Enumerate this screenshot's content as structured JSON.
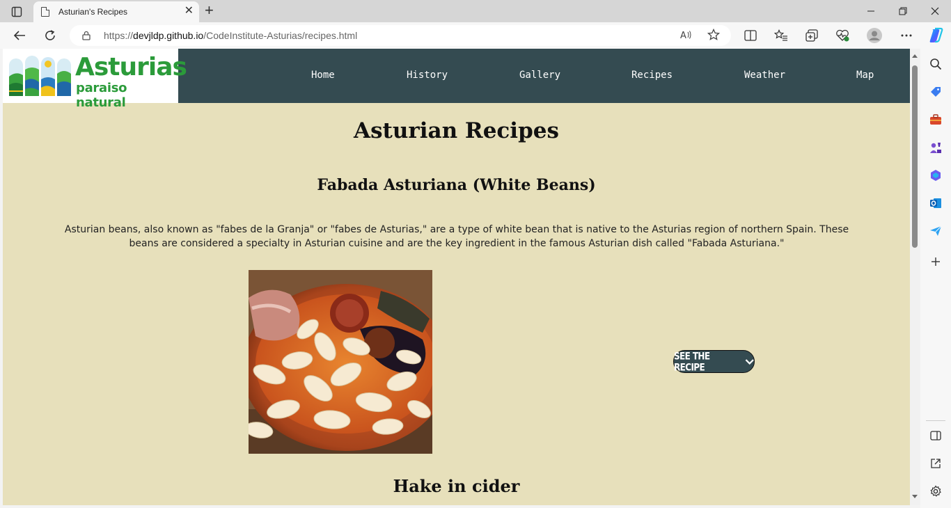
{
  "browser": {
    "tab_title": "Asturian's Recipes",
    "url_prefix": "https://",
    "url_domain": "devjldp.github.io",
    "url_path": "/CodeInstitute-Asturias/recipes.html",
    "read_aloud_label": "A̅"
  },
  "site": {
    "logo_line1": "Asturias",
    "logo_line2": "paraiso natural",
    "nav": [
      "Home",
      "History",
      "Gallery",
      "Recipes",
      "Weather",
      "Map"
    ]
  },
  "main": {
    "page_title": "Asturian Recipes",
    "recipes": [
      {
        "title": "Fabada Asturiana (White Beans)",
        "description": "Asturian beans, also known as \"fabes de la Granja\" or \"fabes de Asturias,\" are a type of white bean that is native to the Asturias region of northern Spain. These beans are considered a specialty in Asturian cuisine and are the key ingredient in the famous Asturian dish called \"Fabada Asturiana.\"",
        "button_label": "SEE THE RECIPE"
      },
      {
        "title": "Hake in cider"
      }
    ]
  },
  "colors": {
    "page_background": "#e7e0bb",
    "header_background": "#344b51",
    "logo_green": "#2b9b3a"
  }
}
